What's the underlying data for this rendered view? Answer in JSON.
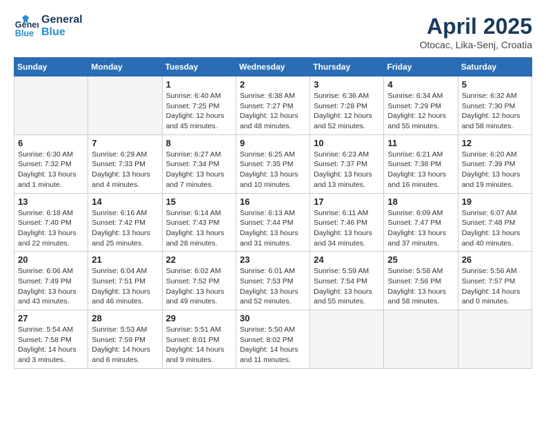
{
  "logo": {
    "line1": "General",
    "line2": "Blue"
  },
  "title": "April 2025",
  "subtitle": "Otocac, Lika-Senj, Croatia",
  "weekdays": [
    "Sunday",
    "Monday",
    "Tuesday",
    "Wednesday",
    "Thursday",
    "Friday",
    "Saturday"
  ],
  "weeks": [
    [
      {
        "day": "",
        "info": ""
      },
      {
        "day": "",
        "info": ""
      },
      {
        "day": "1",
        "info": "Sunrise: 6:40 AM\nSunset: 7:25 PM\nDaylight: 12 hours and 45 minutes."
      },
      {
        "day": "2",
        "info": "Sunrise: 6:38 AM\nSunset: 7:27 PM\nDaylight: 12 hours and 48 minutes."
      },
      {
        "day": "3",
        "info": "Sunrise: 6:36 AM\nSunset: 7:28 PM\nDaylight: 12 hours and 52 minutes."
      },
      {
        "day": "4",
        "info": "Sunrise: 6:34 AM\nSunset: 7:29 PM\nDaylight: 12 hours and 55 minutes."
      },
      {
        "day": "5",
        "info": "Sunrise: 6:32 AM\nSunset: 7:30 PM\nDaylight: 12 hours and 58 minutes."
      }
    ],
    [
      {
        "day": "6",
        "info": "Sunrise: 6:30 AM\nSunset: 7:32 PM\nDaylight: 13 hours and 1 minute."
      },
      {
        "day": "7",
        "info": "Sunrise: 6:29 AM\nSunset: 7:33 PM\nDaylight: 13 hours and 4 minutes."
      },
      {
        "day": "8",
        "info": "Sunrise: 6:27 AM\nSunset: 7:34 PM\nDaylight: 13 hours and 7 minutes."
      },
      {
        "day": "9",
        "info": "Sunrise: 6:25 AM\nSunset: 7:35 PM\nDaylight: 13 hours and 10 minutes."
      },
      {
        "day": "10",
        "info": "Sunrise: 6:23 AM\nSunset: 7:37 PM\nDaylight: 13 hours and 13 minutes."
      },
      {
        "day": "11",
        "info": "Sunrise: 6:21 AM\nSunset: 7:38 PM\nDaylight: 13 hours and 16 minutes."
      },
      {
        "day": "12",
        "info": "Sunrise: 6:20 AM\nSunset: 7:39 PM\nDaylight: 13 hours and 19 minutes."
      }
    ],
    [
      {
        "day": "13",
        "info": "Sunrise: 6:18 AM\nSunset: 7:40 PM\nDaylight: 13 hours and 22 minutes."
      },
      {
        "day": "14",
        "info": "Sunrise: 6:16 AM\nSunset: 7:42 PM\nDaylight: 13 hours and 25 minutes."
      },
      {
        "day": "15",
        "info": "Sunrise: 6:14 AM\nSunset: 7:43 PM\nDaylight: 13 hours and 28 minutes."
      },
      {
        "day": "16",
        "info": "Sunrise: 6:13 AM\nSunset: 7:44 PM\nDaylight: 13 hours and 31 minutes."
      },
      {
        "day": "17",
        "info": "Sunrise: 6:11 AM\nSunset: 7:46 PM\nDaylight: 13 hours and 34 minutes."
      },
      {
        "day": "18",
        "info": "Sunrise: 6:09 AM\nSunset: 7:47 PM\nDaylight: 13 hours and 37 minutes."
      },
      {
        "day": "19",
        "info": "Sunrise: 6:07 AM\nSunset: 7:48 PM\nDaylight: 13 hours and 40 minutes."
      }
    ],
    [
      {
        "day": "20",
        "info": "Sunrise: 6:06 AM\nSunset: 7:49 PM\nDaylight: 13 hours and 43 minutes."
      },
      {
        "day": "21",
        "info": "Sunrise: 6:04 AM\nSunset: 7:51 PM\nDaylight: 13 hours and 46 minutes."
      },
      {
        "day": "22",
        "info": "Sunrise: 6:02 AM\nSunset: 7:52 PM\nDaylight: 13 hours and 49 minutes."
      },
      {
        "day": "23",
        "info": "Sunrise: 6:01 AM\nSunset: 7:53 PM\nDaylight: 13 hours and 52 minutes."
      },
      {
        "day": "24",
        "info": "Sunrise: 5:59 AM\nSunset: 7:54 PM\nDaylight: 13 hours and 55 minutes."
      },
      {
        "day": "25",
        "info": "Sunrise: 5:58 AM\nSunset: 7:56 PM\nDaylight: 13 hours and 58 minutes."
      },
      {
        "day": "26",
        "info": "Sunrise: 5:56 AM\nSunset: 7:57 PM\nDaylight: 14 hours and 0 minutes."
      }
    ],
    [
      {
        "day": "27",
        "info": "Sunrise: 5:54 AM\nSunset: 7:58 PM\nDaylight: 14 hours and 3 minutes."
      },
      {
        "day": "28",
        "info": "Sunrise: 5:53 AM\nSunset: 7:59 PM\nDaylight: 14 hours and 6 minutes."
      },
      {
        "day": "29",
        "info": "Sunrise: 5:51 AM\nSunset: 8:01 PM\nDaylight: 14 hours and 9 minutes."
      },
      {
        "day": "30",
        "info": "Sunrise: 5:50 AM\nSunset: 8:02 PM\nDaylight: 14 hours and 11 minutes."
      },
      {
        "day": "",
        "info": ""
      },
      {
        "day": "",
        "info": ""
      },
      {
        "day": "",
        "info": ""
      }
    ]
  ]
}
